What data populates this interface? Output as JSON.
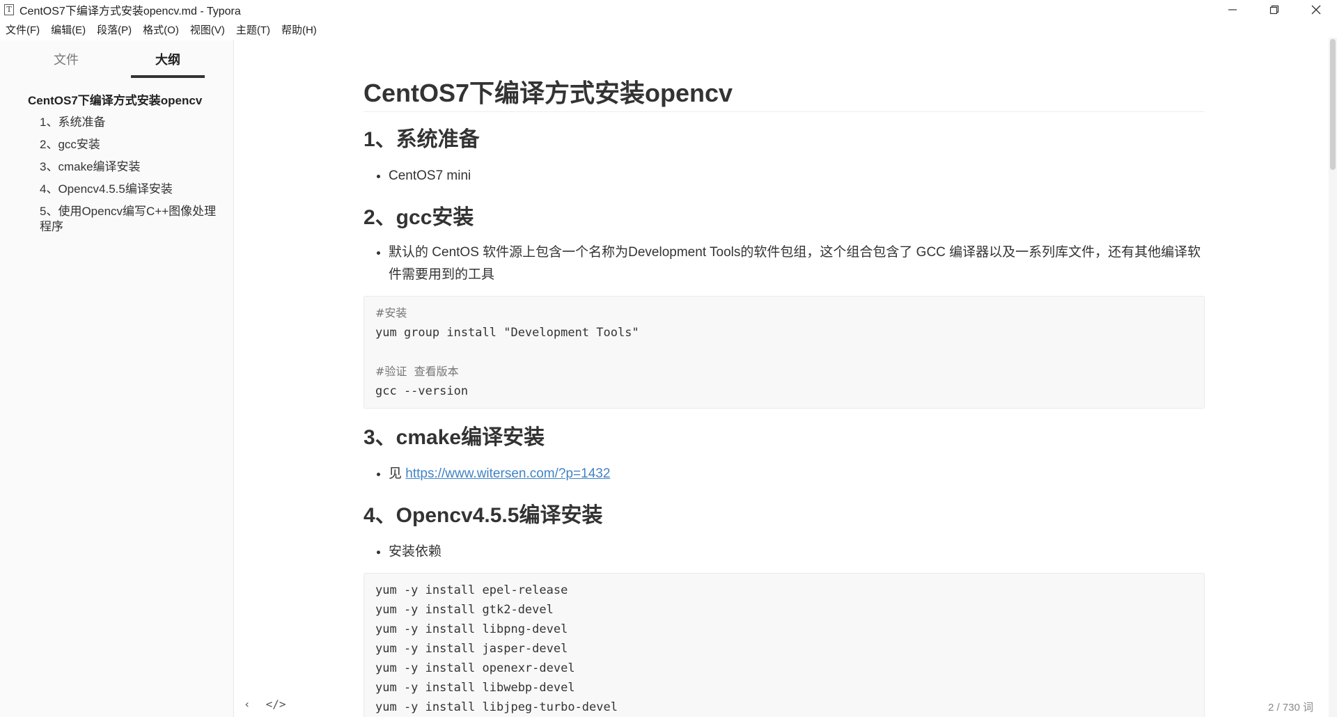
{
  "window": {
    "app_icon_letter": "T",
    "title": "CentOS7下编译方式安装opencv.md - Typora"
  },
  "menu": [
    {
      "label": "文件(F)"
    },
    {
      "label": "编辑(E)"
    },
    {
      "label": "段落(P)"
    },
    {
      "label": "格式(O)"
    },
    {
      "label": "视图(V)"
    },
    {
      "label": "主题(T)"
    },
    {
      "label": "帮助(H)"
    }
  ],
  "sidebar": {
    "tabs": {
      "files": "文件",
      "outline": "大纲"
    },
    "outline": [
      {
        "label": "CentOS7下编译方式安装opencv"
      },
      {
        "label": "1、系统准备"
      },
      {
        "label": "2、gcc安装"
      },
      {
        "label": "3、cmake编译安装"
      },
      {
        "label": "4、Opencv4.5.5编译安装"
      },
      {
        "label": "5、使用Opencv编写C++图像处理程序"
      }
    ]
  },
  "doc": {
    "title": "CentOS7下编译方式安装opencv",
    "s1": {
      "heading": "1、系统准备",
      "bullet": "CentOS7 mini"
    },
    "s2": {
      "heading": "2、gcc安装",
      "bullet": "默认的 CentOS 软件源上包含一个名称为Development Tools的软件包组，这个组合包含了 GCC 编译器以及一系列库文件，还有其他编译软件需要用到的工具",
      "code": [
        "#安装",
        "yum group install \"Development Tools\"",
        "",
        "#验证  查看版本",
        "gcc --version"
      ]
    },
    "s3": {
      "heading": "3、cmake编译安装",
      "bullet_prefix": "见 ",
      "link": "https://www.witersen.com/?p=1432"
    },
    "s4": {
      "heading": "4、Opencv4.5.5编译安装",
      "bullet": "安装依赖",
      "code": [
        "yum -y install epel-release",
        "yum -y install gtk2-devel",
        "yum -y install libpng-devel",
        "yum -y install jasper-devel",
        "yum -y install openexr-devel",
        "yum -y install libwebp-devel",
        "yum -y install libjpeg-turbo-devel"
      ]
    }
  },
  "footer": {
    "back": "‹",
    "source": "</>",
    "word_count": "2 / 730 词"
  }
}
